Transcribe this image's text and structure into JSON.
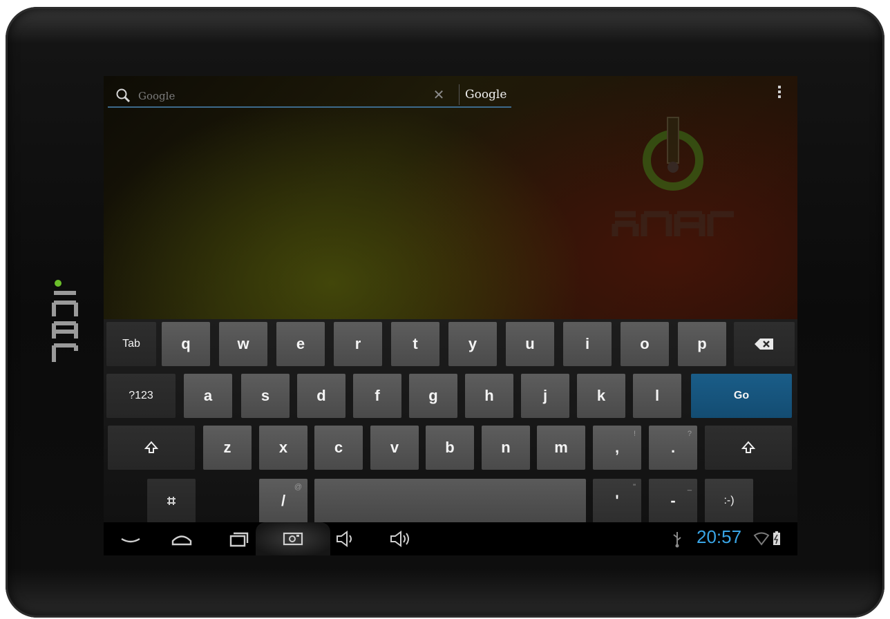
{
  "device": {
    "bezel_brand": "inar"
  },
  "search": {
    "placeholder": "Google",
    "brand_label": "Google"
  },
  "keyboard": {
    "row1": [
      "Tab",
      "q",
      "w",
      "e",
      "r",
      "t",
      "y",
      "u",
      "i",
      "o",
      "p"
    ],
    "row2": [
      "?123",
      "a",
      "s",
      "d",
      "f",
      "g",
      "h",
      "j",
      "k",
      "l",
      "Go"
    ],
    "row3": [
      "z",
      "x",
      "c",
      "v",
      "b",
      "n",
      "m",
      ",",
      "."
    ],
    "row3_hints": [
      "!",
      "?"
    ],
    "row4": [
      "/",
      "'",
      "-",
      ":-)"
    ],
    "row4_hints": [
      "@",
      "\"",
      "_"
    ]
  },
  "status": {
    "time": "20:57"
  },
  "colors": {
    "accent": "#39a5e6",
    "go_key": "#1a5d88",
    "key": "#555555",
    "fn_key": "#2a2a2a"
  }
}
